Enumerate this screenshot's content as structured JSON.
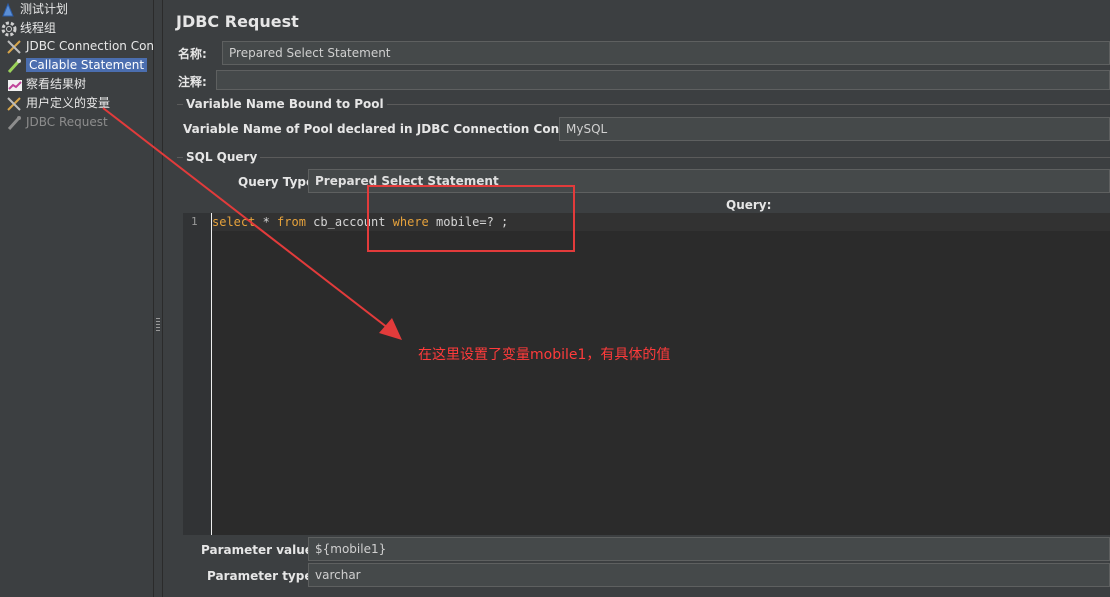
{
  "tree": {
    "items": [
      {
        "label": "测试计划",
        "icon": "test-plan-icon"
      },
      {
        "label": "线程组",
        "icon": "gear-icon"
      },
      {
        "label": "JDBC Connection Con",
        "icon": "wrench-icon"
      },
      {
        "label": "Callable  Statement",
        "icon": "pipette-icon"
      },
      {
        "label": "察看结果树",
        "icon": "chart-icon"
      },
      {
        "label": "用户定义的变量",
        "icon": "wrench-icon"
      },
      {
        "label": "JDBC Request",
        "icon": "pipette-icon"
      }
    ]
  },
  "panel": {
    "title": "JDBC Request",
    "name_label": "名称:",
    "name_value": "Prepared Select  Statement",
    "comment_label": "注释:",
    "comment_value": "",
    "pool_group_title": "Variable Name Bound to Pool",
    "pool_label": "Variable Name of Pool declared in JDBC Connection Configuration:",
    "pool_value": "MySQL",
    "sql_group_title": "SQL Query",
    "query_type_label": "Query Type:",
    "query_type_value": "Prepared Select Statement",
    "query_header": "Query:",
    "query_line_number": "1",
    "query_code": {
      "kw1": "select",
      "t1": " * ",
      "kw2": "from",
      "t2": " cb_account ",
      "kw3": "where",
      "t3": " mobile=? ;"
    },
    "param_values_label": "Parameter values:",
    "param_values_value": "${mobile1}",
    "param_types_label": "Parameter types:",
    "param_types_value": "varchar"
  },
  "annotation": {
    "text": "在这里设置了变量mobile1，有具体的值",
    "color": "#ff3b3b"
  }
}
